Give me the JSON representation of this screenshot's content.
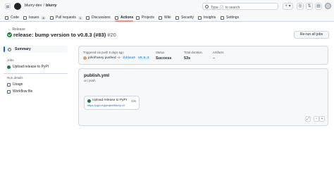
{
  "header": {
    "owner": "blurry-dev",
    "separator": "/",
    "repo": "blurry",
    "search_prefix": "Type",
    "search_key": "/",
    "search_suffix": "to search",
    "plus_label": "+",
    "chevron": "▾",
    "icons": [
      "issues-icon",
      "pull-requests-icon",
      "inbox-icon"
    ]
  },
  "tabs": [
    {
      "label": "Code",
      "icon": "code-icon"
    },
    {
      "label": "Issues",
      "count": "8",
      "icon": "issue-icon"
    },
    {
      "label": "Pull requests",
      "count": "1",
      "icon": "pr-icon"
    },
    {
      "label": "Discussions",
      "icon": "discussion-icon"
    },
    {
      "label": "Actions",
      "icon": "play-icon",
      "active": true
    },
    {
      "label": "Projects",
      "icon": "table-icon"
    },
    {
      "label": "Wiki",
      "icon": "book-icon"
    },
    {
      "label": "Security",
      "icon": "shield-icon"
    },
    {
      "label": "Insights",
      "icon": "graph-icon"
    },
    {
      "label": "Settings",
      "icon": "gear-icon"
    }
  ],
  "page": {
    "back_label": "← Release",
    "title": "release: bump version to v0.8.3 (#83)",
    "run_number": "#20",
    "rerun_label": "Re-run all jobs"
  },
  "sidebar": {
    "summary_label": "Summary",
    "jobs_heading": "Jobs",
    "jobs": [
      {
        "label": "Upload release to PyPI",
        "status": "success"
      }
    ],
    "details_heading": "Run details",
    "details": [
      {
        "label": "Usage"
      },
      {
        "label": "Workflow file"
      }
    ]
  },
  "summary": {
    "trigger_text": "Triggered via push 5 days ago",
    "actor": "johnfraney",
    "pushed_label": "pushed",
    "arrow": "-o-",
    "commit": "1bbbaa9",
    "branch": "v0.8.3",
    "status_label": "Status",
    "status_value": "Success",
    "duration_label": "Total duration",
    "duration_value": "53s",
    "artifacts_label": "Artifacts",
    "artifacts_value": "–"
  },
  "workflow": {
    "file": "publish.yml",
    "event": "on: push",
    "job": {
      "name": "Upload release to PyPI",
      "duration": "43s",
      "url": "https://pypi.org/project/blurry-cli"
    },
    "zoom_fit": "⤢",
    "zoom_out": "−",
    "zoom_in": "+"
  },
  "colors": {
    "success": "#1a7f37",
    "link": "#0969da",
    "active_tab": "#fd8c73"
  }
}
